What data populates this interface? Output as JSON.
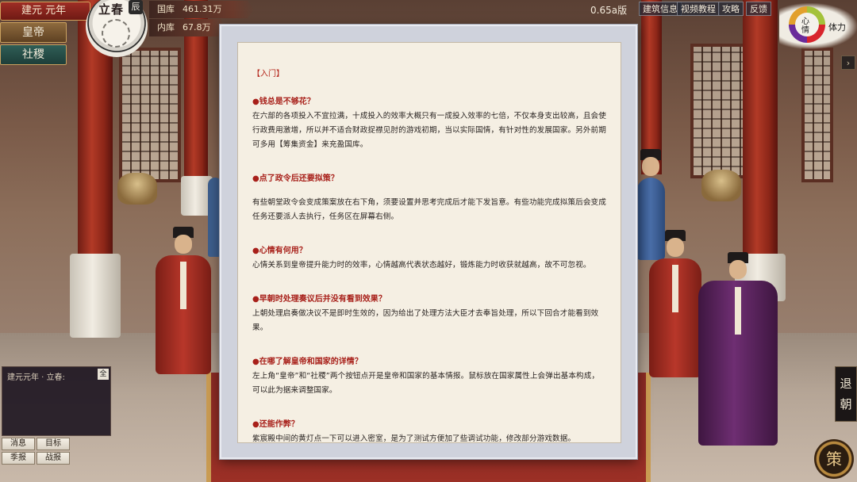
{
  "top_left": {
    "era": "建元 元年",
    "season": "立春",
    "season_seal": "辰",
    "nav_emperor": "皇帝",
    "nav_state": "社稷"
  },
  "treasury": {
    "national_label": "国库",
    "national_value": "461.31万",
    "inner_label": "内库",
    "inner_value": "67.8万"
  },
  "top_right": {
    "version": "0.65a版",
    "links": [
      "建筑信息",
      "视频教程",
      "攻略",
      "反馈"
    ],
    "mood_label": "心情",
    "stamina_label": "体力",
    "side_arrow": "›"
  },
  "dialog": {
    "header": "【入门】",
    "sections": [
      {
        "q": "●钱总是不够花？",
        "a": "在六部的各项投入不宜拉满，十成投入的效率大概只有一成投入效率的七倍，不仅本身支出较高，且会使行政费用激增，所以并不适合财政捉襟见肘的游戏初期，当以实际国情，有针对性的发展国家。另外前期可多用【筹集资金】来充盈国库。"
      },
      {
        "q": "●点了政令后还要拟策？",
        "a": "有些朝堂政令会变成策案放在右下角，须要设置并思考完成后才能下发旨意。有些功能完成拟策后会变成任务还要派人去执行，任务区在屏幕右侧。"
      },
      {
        "q": "●心情有何用？",
        "a": "心情关系到皇帝提升能力时的效率，心情越高代表状态越好，锻炼能力时收获就越高，故不可忽视。"
      },
      {
        "q": "●早朝时处理奏议后并没有看到效果？",
        "a": "上朝处理启奏做决议不是即时生效的，因为给出了处理方法大臣才去奉旨处理，所以下回合才能看到效果。"
      },
      {
        "q": "●在哪了解皇帝和国家的详情？",
        "a": "左上角“皇帝”和“社稷”两个按钮点开是皇帝和国家的基本情报。鼠标放在国家属性上会弹出基本构成，可以此为据来调整国家。"
      },
      {
        "q": "●还能作弊？",
        "a": "紫宸殿中间的黄灯点一下可以进入密室，是为了测试方便加了些调试功能，修改部分游戏数据。"
      }
    ]
  },
  "log": {
    "title": "建元元年 · 立春:",
    "all_button": "全",
    "buttons": [
      "消息",
      "目标",
      "季报",
      "战报"
    ]
  },
  "right_controls": {
    "retreat_line1": "退",
    "retreat_line2": "朝",
    "policy": "策"
  }
}
